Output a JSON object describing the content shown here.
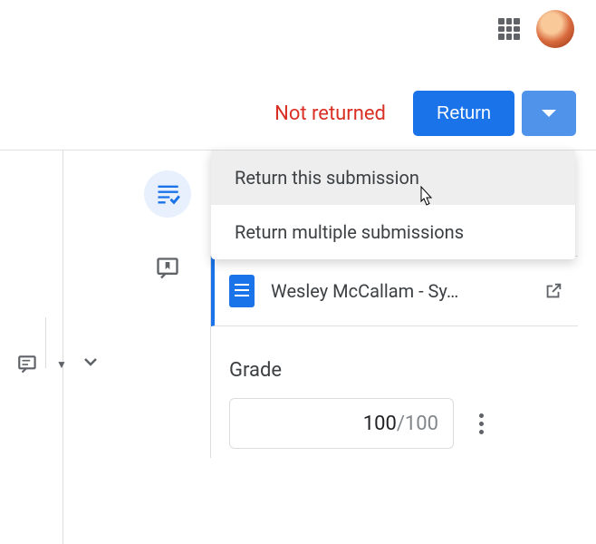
{
  "header": {
    "apps_icon": "apps-grid",
    "avatar": "user-avatar"
  },
  "action_bar": {
    "status_text": "Not returned",
    "return_button_label": "Return"
  },
  "dropdown": {
    "items": [
      {
        "label": "Return this submission",
        "highlighted": true
      },
      {
        "label": "Return multiple submissions",
        "highlighted": false
      }
    ]
  },
  "tool_column": {
    "tool_active": "grading-tool",
    "tool_comment": "comment-bank"
  },
  "submission": {
    "file_name": "Wesley McCallam - Sy…",
    "file_icon": "google-doc"
  },
  "grade": {
    "label": "Grade",
    "value": "100",
    "max": "/100"
  }
}
